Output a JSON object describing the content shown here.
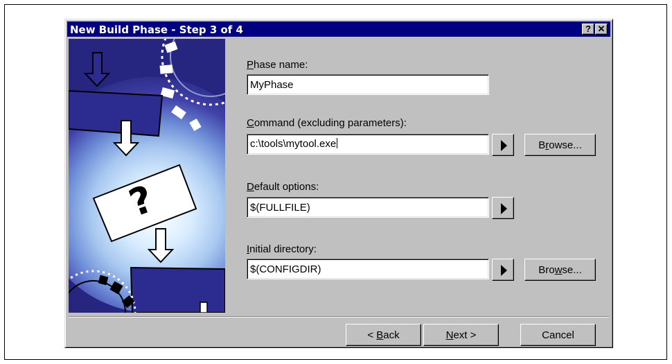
{
  "dialog": {
    "title": "New Build Phase - Step 3 of 4",
    "help_label": "?",
    "close_label": "✕"
  },
  "fields": {
    "phase_name": {
      "label_accel": "P",
      "label_rest": "hase name:",
      "value": "MyPhase"
    },
    "command": {
      "label_accel": "C",
      "label_rest": "ommand (excluding parameters):",
      "value": "c:\\tools\\mytool.exe",
      "browse_pre": "B",
      "browse_accel": "r",
      "browse_post": "owse..."
    },
    "default_options": {
      "label_accel": "D",
      "label_rest": "efault options:",
      "value": "$(FULLFILE)"
    },
    "initial_directory": {
      "label_accel": "I",
      "label_rest": "nitial directory:",
      "value": "$(CONFIGDIR)",
      "browse_pre": "Bro",
      "browse_accel": "w",
      "browse_post": "se..."
    }
  },
  "footer": {
    "back_pre": "< ",
    "back_accel": "B",
    "back_post": "ack",
    "next_accel": "N",
    "next_post": "ext >",
    "cancel_label": "Cancel"
  },
  "colors": {
    "titlebar": "#000080",
    "dialog_face": "#c0c0c0",
    "illustration_bg": "#2a2a8a",
    "illustration_glow": "#a8c8f0"
  },
  "icons": {
    "help": "question-mark-icon",
    "close": "close-icon",
    "arrow": "right-triangle-icon"
  }
}
